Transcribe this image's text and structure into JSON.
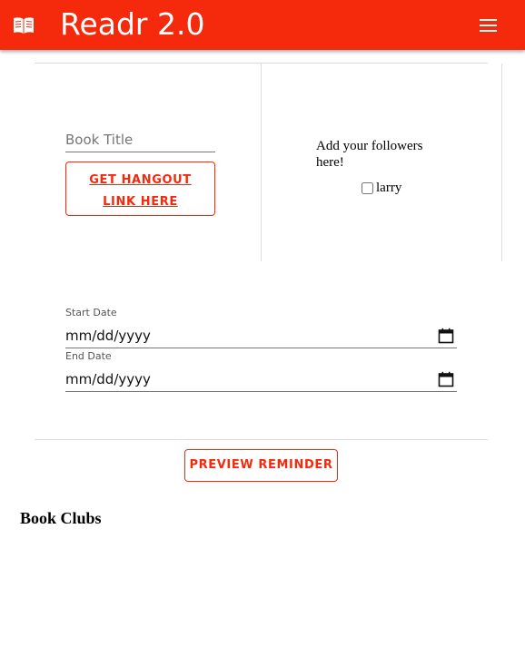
{
  "app": {
    "title": "Readr 2.0",
    "logo_icon": "book-icon",
    "menu_icon": "hamburger-menu-icon",
    "brand_color": "#f5290c"
  },
  "form": {
    "book_title_placeholder": "Book Title",
    "hangout_button_line1": "GET HANGOUT",
    "hangout_button_line2": "LINK HERE",
    "followers_label": "Add your followers here!",
    "followers": [
      {
        "name": "larry",
        "checked": false
      }
    ],
    "start_date_label": "Start Date",
    "start_date_value": "mm/dd/yyyy",
    "end_date_label": "End Date",
    "end_date_value": "mm/dd/yyyy",
    "preview_button": "PREVIEW REMINDER"
  },
  "book_clubs": {
    "heading": "Book Clubs"
  }
}
